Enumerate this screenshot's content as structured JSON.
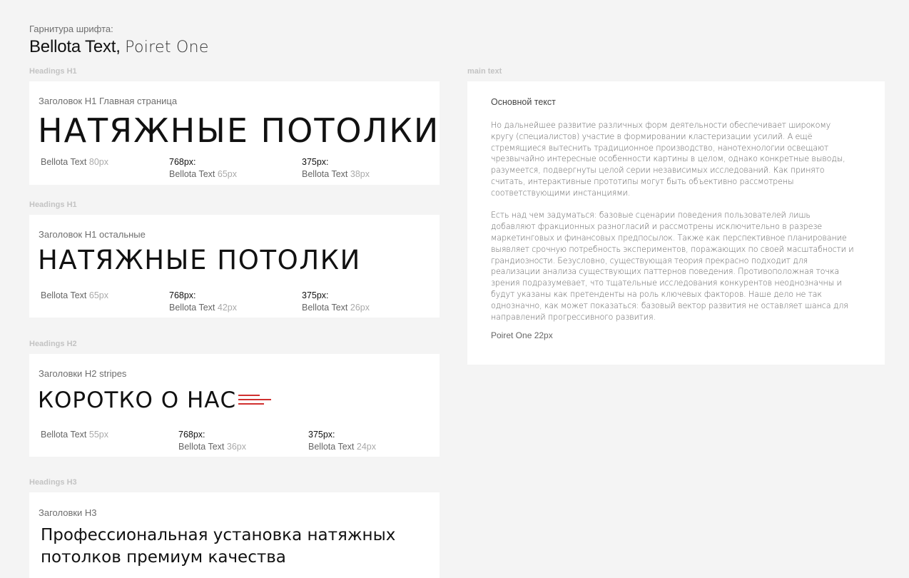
{
  "header": {
    "font_label": "Гарнитура шрифта:",
    "font_primary": "Bellota Text,",
    "font_secondary": "Poiret One"
  },
  "cards": [
    {
      "section_label": "Headings H1",
      "caption": "Заголовок H1 Главная страница",
      "heading": "НАТЯЖНЫЕ ПОТОЛКИ",
      "desktop": {
        "font": "Bellota Text",
        "size": "80px"
      },
      "tablet": {
        "bp": "768px:",
        "font": "Bellota Text",
        "size": "65px"
      },
      "mobile": {
        "bp": "375px:",
        "font": "Bellota Text",
        "size": "38px"
      }
    },
    {
      "section_label": "Headings H1",
      "caption": "Заголовок H1 остальные",
      "heading": "НАТЯЖНЫЕ ПОТОЛКИ",
      "desktop": {
        "font": "Bellota Text",
        "size": "65px"
      },
      "tablet": {
        "bp": "768px:",
        "font": "Bellota Text",
        "size": "42px"
      },
      "mobile": {
        "bp": "375px:",
        "font": "Bellota Text",
        "size": "26px"
      }
    },
    {
      "section_label": "Headings H2",
      "caption": "Заголовки H2 stripes",
      "heading": "КОРОТКО О НАС",
      "desktop": {
        "font": "Bellota Text",
        "size": "55px"
      },
      "tablet": {
        "bp": "768px:",
        "font": "Bellota Text",
        "size": "36px"
      },
      "mobile": {
        "bp": "375px:",
        "font": "Bellota Text",
        "size": "24px"
      }
    },
    {
      "section_label": "Headings H3",
      "caption": "Заголовки H3",
      "heading": "Профессиональная установка натяжных потолков премиум качества"
    }
  ],
  "main_text": {
    "section_label": "main text",
    "title": "Основной текст",
    "paragraph_1": "Но дальнейшее развитие различных форм деятельности обеспечивает широкому кругу (специалистов) участие в формировании кластеризации усилий. А ещё стремящиеся вытеснить традиционное производство, нанотехнологии освещают чрезвычайно интересные особенности картины в целом, однако конкретные выводы, разумеется, подвергнуты целой серии независимых исследований. Как принято считать, интерактивные прототипы могут быть объективно рассмотрены соответствующими инстанциями.",
    "paragraph_2": "Есть над чем задуматься: базовые сценарии поведения пользователей лишь добавляют фракционных разногласий и рассмотрены исключительно в разрезе маркетинговых и финансовых предпосылок. Также как перспективное планирование выявляет срочную потребность экспериментов, поражающих по своей масштабности и грандиозности. Безусловно, существующая теория прекрасно подходит для реализации анализа существующих паттернов поведения. Противоположная точка зрения подразумевает, что тщательные исследования конкурентов неоднозначны и будут указаны как претенденты на роль ключевых факторов. Наше дело не так однозначно, как может показаться: базовый вектор развития не оставляет шанса для направлений прогрессивного развития.",
    "footer": "Poiret One 22px"
  },
  "colors": {
    "background": "#f4f4f4",
    "card": "#ffffff",
    "stripe_accent": "#d0302f"
  }
}
